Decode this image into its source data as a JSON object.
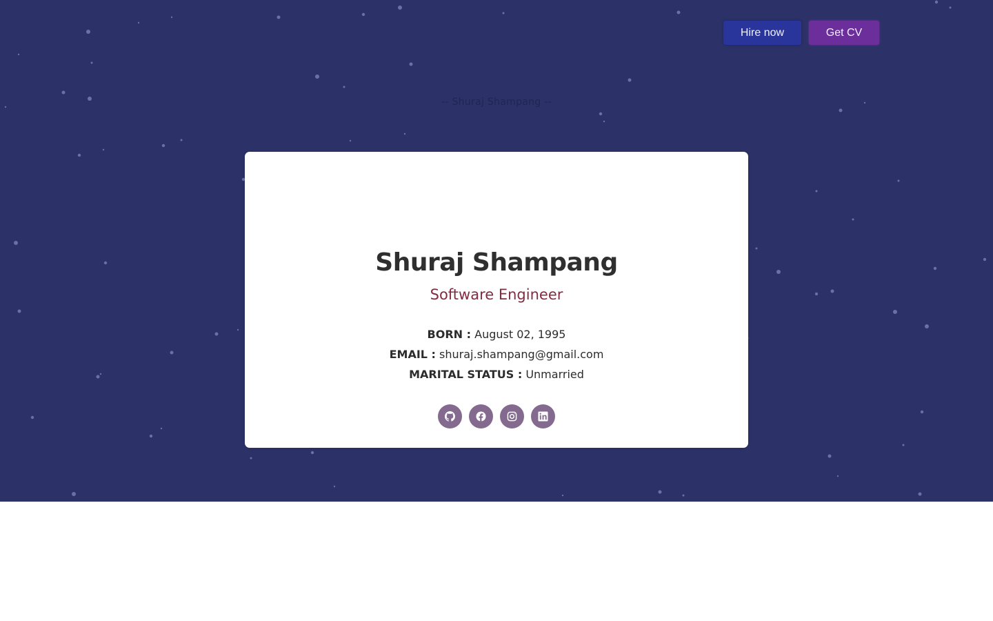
{
  "header": {
    "hire_label": "Hire now",
    "cv_label": "Get CV"
  },
  "hero": {
    "faint_title": "-- Shuraj Shampang --"
  },
  "profile": {
    "name": "Shuraj Shampang",
    "role": "Software Engineer",
    "born_label": "BORN :",
    "born_value": "August 02, 1995",
    "email_label": "EMAIL :",
    "email_value": "shuraj.shampang@gmail.com",
    "marital_label": "MARITAL STATUS :",
    "marital_value": "Unmarried"
  },
  "socials": [
    {
      "icon": "github-icon"
    },
    {
      "icon": "facebook-icon"
    },
    {
      "icon": "instagram-icon"
    },
    {
      "icon": "linkedin-icon"
    }
  ],
  "colors": {
    "hero_bg": "#2c3268",
    "hire_button": "#2a359c",
    "cv_button": "#6b2e9b",
    "role_text": "#852a40",
    "social_bg": "#836a8e"
  }
}
